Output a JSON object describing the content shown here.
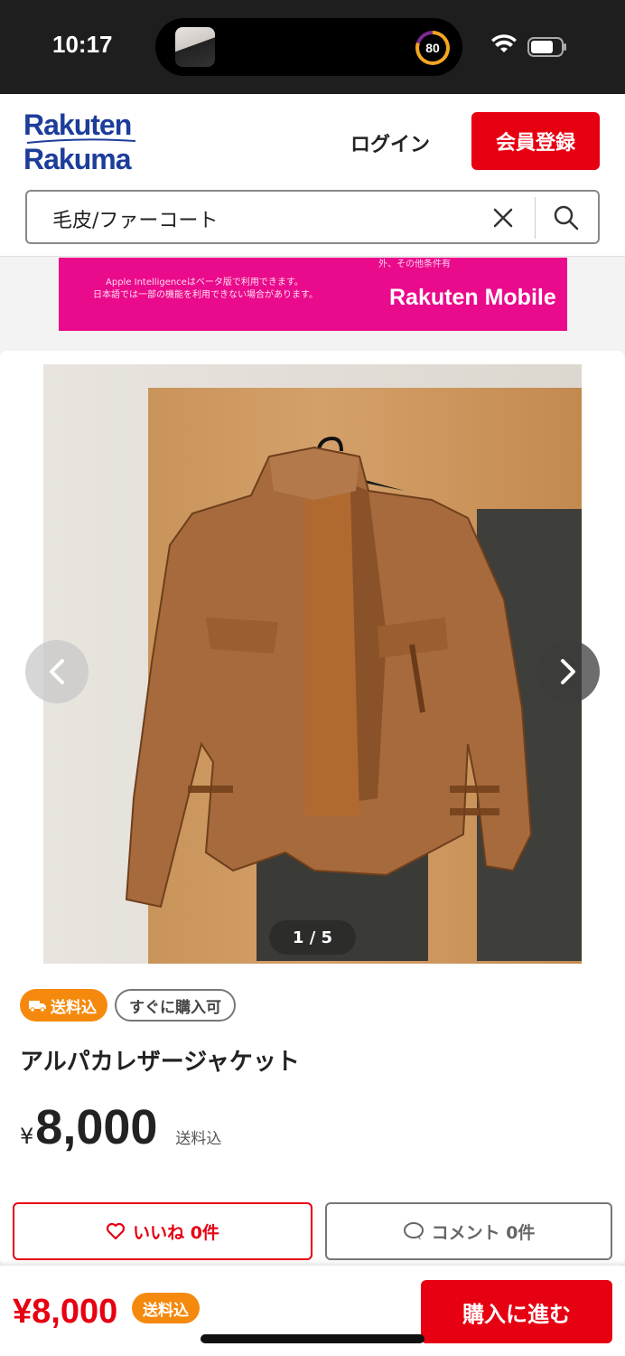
{
  "status_bar": {
    "time": "10:17",
    "activity_value": "80"
  },
  "header": {
    "logo_line1": "Rakuten",
    "logo_line2": "Rakuma",
    "login_label": "ログイン",
    "signup_label": "会員登録"
  },
  "search": {
    "value": "毛皮/ファーコート"
  },
  "banner": {
    "top_text": "外、その他条件有",
    "line1": "Apple Intelligenceはベータ版で利用できます。",
    "line2": "日本語では一部の機能を利用できない場合があります。",
    "brand": "Rakuten Mobile"
  },
  "product": {
    "image_counter": "1 / 5",
    "tags": {
      "shipping": "送料込",
      "instant": "すぐに購入可"
    },
    "title": "アルパカレザージャケット",
    "price_yen": "¥",
    "price_value": "8,000",
    "price_note": "送料込",
    "like_label": "いいね 0件",
    "comment_label": "コメント 0件"
  },
  "bottom_bar": {
    "price": "¥8,000",
    "shipping_badge": "送料込",
    "buy_label": "購入に進む"
  },
  "colors": {
    "brand_red": "#e60012",
    "tag_orange": "#f5890d",
    "rakuten_blue": "#1d3d9b",
    "banner_pink": "#ea0a8c"
  }
}
